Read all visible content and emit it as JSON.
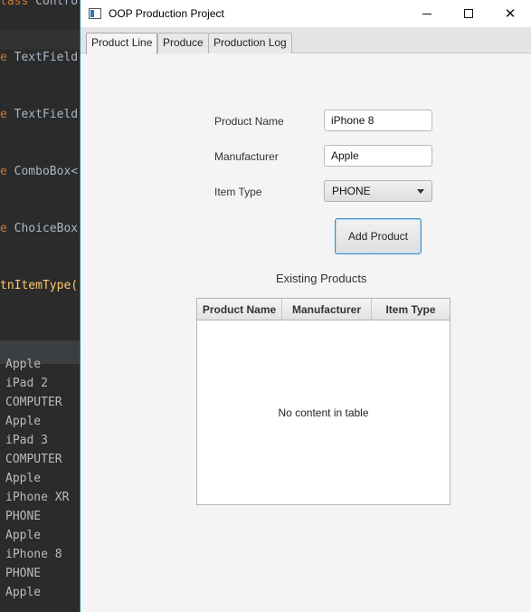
{
  "ide": {
    "code_lines": [
      {
        "kw": "tass",
        "rest": " Contro"
      },
      {
        "kw": "e",
        "rest": " TextField"
      },
      {
        "kw": "e",
        "rest": " TextField"
      },
      {
        "kw": "e",
        "rest": " ComboBox<"
      },
      {
        "kw": "e",
        "rest": " ChoiceBox"
      },
      {
        "kw": "",
        "rest": "tnItemType("
      }
    ],
    "console_lines": [
      "Apple",
      "iPad 2",
      "COMPUTER",
      "Apple",
      "iPad 3",
      "COMPUTER",
      "Apple",
      "iPhone XR",
      "PHONE",
      "Apple",
      "iPhone 8",
      "PHONE",
      "Apple"
    ]
  },
  "window": {
    "title": "OOP Production Project",
    "controls": {
      "minimize": "minimize-icon",
      "maximize": "maximize-icon",
      "close": "close-icon",
      "close_glyph": "✕"
    }
  },
  "tabs": [
    {
      "label": "Product Line",
      "active": true
    },
    {
      "label": "Produce",
      "active": false
    },
    {
      "label": "Production Log",
      "active": false
    }
  ],
  "form": {
    "product_name_label": "Product Name",
    "product_name_value": "iPhone 8",
    "manufacturer_label": "Manufacturer",
    "manufacturer_value": "Apple",
    "item_type_label": "Item Type",
    "item_type_value": "PHONE",
    "add_button_label": "Add Product"
  },
  "table": {
    "title": "Existing Products",
    "columns": [
      "Product Name",
      "Manufacturer",
      "Item Type"
    ],
    "empty_text": "No content in table"
  },
  "colors": {
    "accent": "#3e8fc9",
    "window_border": "#2a7b86",
    "ide_keyword": "#cc7832"
  }
}
